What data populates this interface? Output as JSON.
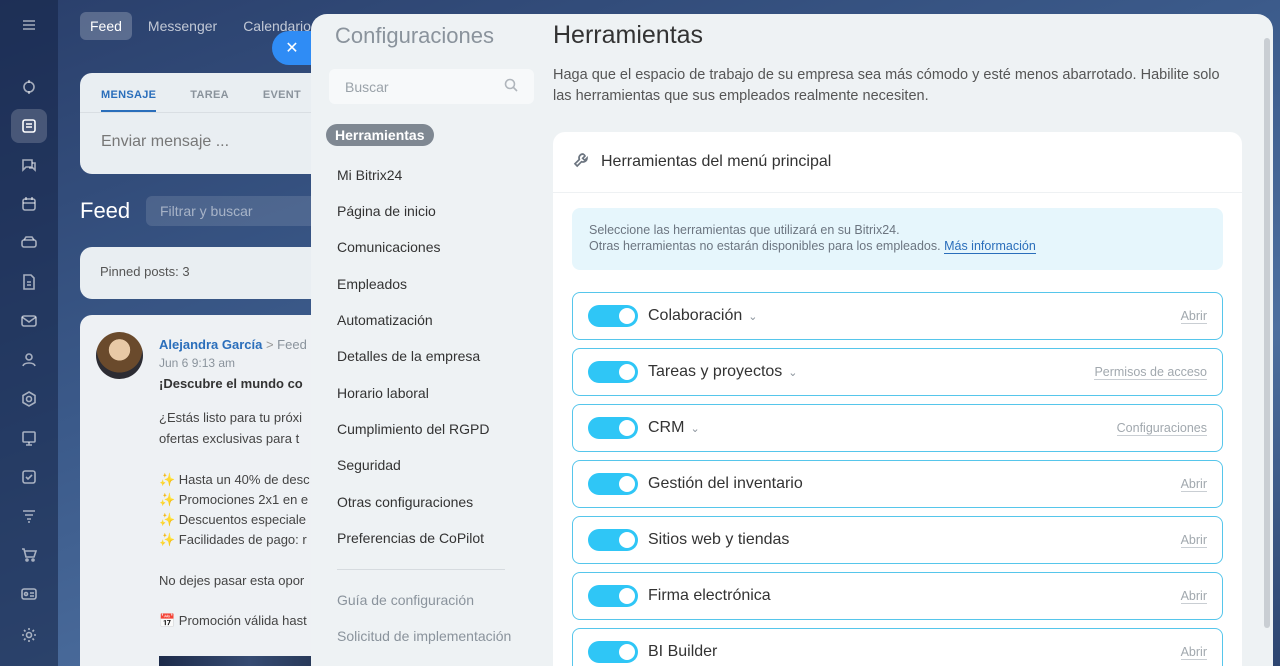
{
  "background": {
    "top_tabs": [
      "Feed",
      "Messenger",
      "Calendario"
    ],
    "composer": {
      "tabs": [
        "MENSAJE",
        "TAREA",
        "EVENT"
      ],
      "placeholder": "Enviar mensaje ..."
    },
    "feed_title": "Feed",
    "filter_placeholder": "Filtrar y buscar",
    "pinned": "Pinned posts: 3",
    "post": {
      "author": "Alejandra García",
      "arrow": ">",
      "destination": "Feed",
      "date": "Jun 6 9:13 am",
      "headline": "¡Descubre el mundo co",
      "lines": [
        "¿Estás listo para tu próxi",
        "ofertas exclusivas para t",
        "✨ Hasta un 40% de desc",
        "✨ Promociones 2x1 en e",
        "✨ Descuentos especiale",
        "✨ Facilidades de pago: r",
        "No dejes pasar esta opor",
        "📅 Promoción válida hast"
      ]
    }
  },
  "rail_icons": [
    "menu-icon",
    "collab-icon",
    "feed-icon",
    "chat-icon",
    "calendar-icon",
    "drive-icon",
    "docs-icon",
    "mail-icon",
    "contacts-icon",
    "hub-icon",
    "board-icon",
    "tasks-icon",
    "filter-icon",
    "cart-icon",
    "id-card-icon",
    "settings-icon"
  ],
  "settings": {
    "title": "Configuraciones",
    "search_placeholder": "Buscar",
    "menu": [
      "Herramientas",
      "Mi Bitrix24",
      "Página de inicio",
      "Comunicaciones",
      "Empleados",
      "Automatización",
      "Detalles de la empresa",
      "Horario laboral",
      "Cumplimiento del RGPD",
      "Seguridad",
      "Otras configuraciones",
      "Preferencias de CoPilot"
    ],
    "secondary_menu": [
      "Guía de configuración",
      "Solicitud de implementación"
    ]
  },
  "main": {
    "title": "Herramientas",
    "description": "Haga que el espacio de trabajo de su empresa sea más cómodo y esté menos abarrotado. Habilite solo las herramientas que sus empleados realmente necesiten.",
    "card_title": "Herramientas del menú principal",
    "info_line1": "Seleccione las herramientas que utilizará en su Bitrix24.",
    "info_line2": "Otras herramientas no estarán disponibles para los empleados.",
    "info_link": "Más información",
    "tools": [
      {
        "name": "Colaboración",
        "action": "Abrir",
        "has_chevron": true,
        "enabled": true
      },
      {
        "name": "Tareas y proyectos",
        "action": "Permisos de acceso",
        "has_chevron": true,
        "enabled": true
      },
      {
        "name": "CRM",
        "action": "Configuraciones",
        "has_chevron": true,
        "enabled": true
      },
      {
        "name": "Gestión del inventario",
        "action": "Abrir",
        "has_chevron": false,
        "enabled": true
      },
      {
        "name": "Sitios web y tiendas",
        "action": "Abrir",
        "has_chevron": false,
        "enabled": true
      },
      {
        "name": "Firma electrónica",
        "action": "Abrir",
        "has_chevron": false,
        "enabled": true
      },
      {
        "name": "BI Builder",
        "action": "Abrir",
        "has_chevron": false,
        "enabled": true
      }
    ],
    "chevron_glyph": "⌄"
  },
  "colors": {
    "toggle_on": "#2fc6f6",
    "row_border": "#56c6eb",
    "link": "#2a6ebb",
    "close_button": "#2f8cf5"
  }
}
